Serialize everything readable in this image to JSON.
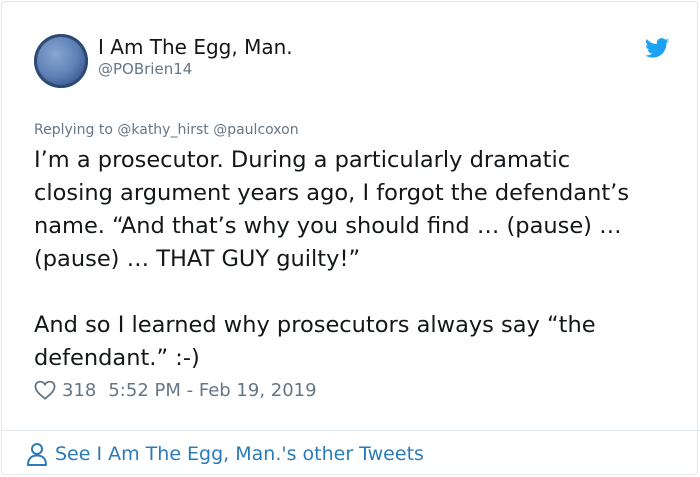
{
  "tweet": {
    "author": {
      "display_name": "I Am The Egg, Man.",
      "handle": "@POBrien14"
    },
    "replying_to": "Replying to @kathy_hirst @paulcoxon",
    "text_lines": [
      "I’m a prosecutor. During a particularly dramatic",
      "closing argument years ago, I forgot the defendant’s",
      "name. “And that’s why you should find … (pause) …",
      "(pause) … THAT GUY guilty!”",
      "And so I learned why prosecutors always say “the",
      "defendant.” :-)"
    ],
    "likes": "318",
    "timestamp": "5:52 PM - Feb 19, 2019"
  },
  "footer": {
    "other_tweets_link": "See I Am The Egg, Man.'s other Tweets"
  },
  "icons": {
    "brand": "twitter-bird-icon",
    "like": "heart-icon",
    "footer": "person-icon"
  },
  "colors": {
    "twitter_blue": "#1da1f2",
    "link_blue": "#2b7bb9",
    "secondary_text": "#657786",
    "border": "#e1e8ed"
  }
}
